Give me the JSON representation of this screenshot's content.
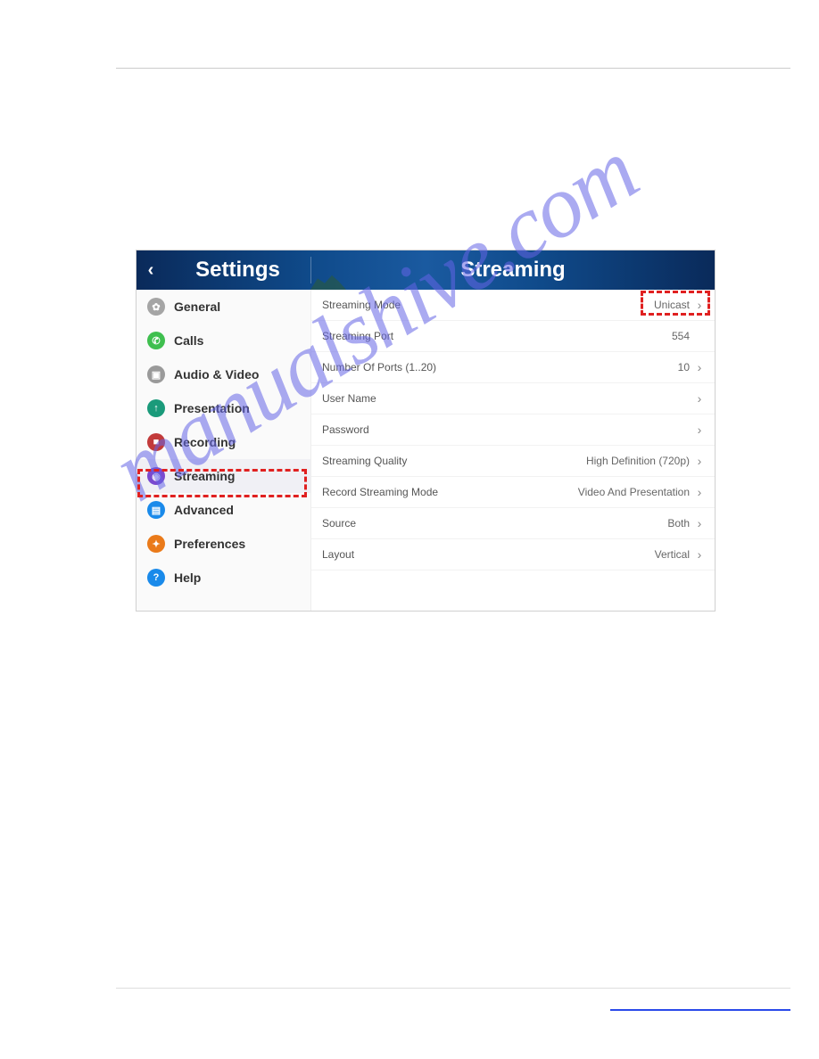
{
  "watermark": "manualshive.com",
  "header": {
    "left_title": "Settings",
    "right_title": "Streaming"
  },
  "sidebar": {
    "items": [
      {
        "label": "General",
        "icon": "gear-icon"
      },
      {
        "label": "Calls",
        "icon": "phone-icon"
      },
      {
        "label": "Audio & Video",
        "icon": "av-icon"
      },
      {
        "label": "Presentation",
        "icon": "up-arrow-icon"
      },
      {
        "label": "Recording",
        "icon": "record-icon"
      },
      {
        "label": "Streaming",
        "icon": "broadcast-icon",
        "selected": true
      },
      {
        "label": "Advanced",
        "icon": "advanced-icon"
      },
      {
        "label": "Preferences",
        "icon": "puzzle-icon"
      },
      {
        "label": "Help",
        "icon": "question-icon"
      }
    ]
  },
  "content": {
    "rows": [
      {
        "label": "Streaming Mode",
        "value": "Unicast",
        "chevron": true,
        "highlighted": true
      },
      {
        "label": "Streaming Port",
        "value": "554",
        "chevron": false
      },
      {
        "label": "Number Of Ports (1..20)",
        "value": "10",
        "chevron": true
      },
      {
        "label": "User Name",
        "value": "",
        "chevron": true
      },
      {
        "label": "Password",
        "value": "",
        "chevron": true
      },
      {
        "label": "Streaming Quality",
        "value": "High Definition (720p)",
        "chevron": true
      },
      {
        "label": "Record Streaming Mode",
        "value": "Video And Presentation",
        "chevron": true
      },
      {
        "label": "Source",
        "value": "Both",
        "chevron": true
      },
      {
        "label": "Layout",
        "value": "Vertical",
        "chevron": true
      }
    ]
  }
}
